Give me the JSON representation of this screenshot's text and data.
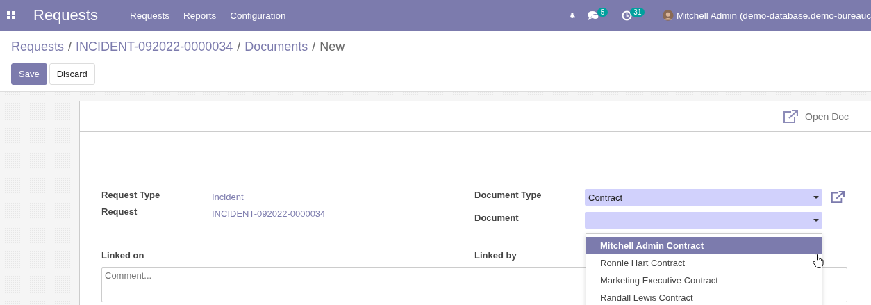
{
  "navbar": {
    "app_title": "Requests",
    "menu": [
      "Requests",
      "Reports",
      "Configuration"
    ],
    "messages_badge": "5",
    "activities_badge": "31",
    "user": "Mitchell Admin (demo-database.demo-bureauc"
  },
  "breadcrumbs": {
    "separator": "/",
    "items": [
      {
        "label": "Requests",
        "current": false
      },
      {
        "label": "INCIDENT-092022-0000034",
        "current": false
      },
      {
        "label": "Documents",
        "current": false
      },
      {
        "label": "New",
        "current": true
      }
    ]
  },
  "buttons": [
    {
      "label": "Save",
      "kind": "primary"
    },
    {
      "label": "Discard",
      "kind": "secondary"
    }
  ],
  "sheet": {
    "header_button": "Open Doc",
    "left_fields": [
      {
        "label": "Request Type",
        "value": "Incident"
      },
      {
        "label": "Request",
        "value": "INCIDENT-092022-0000034"
      }
    ],
    "right_fields": [
      {
        "label": "Document Type",
        "value": "Contract",
        "external_link": true
      },
      {
        "label": "Document",
        "external_link": false
      }
    ],
    "linked_on": {
      "label": "Linked on"
    },
    "linked_by": {
      "label": "Linked by"
    },
    "comment": {
      "placeholder": "Comment..."
    },
    "dropdown": {
      "options": [
        {
          "label": "Mitchell Admin Contract",
          "selected": true
        },
        {
          "label": "Ronnie Hart Contract",
          "selected": false
        },
        {
          "label": "Marketing Executive Contract",
          "selected": false
        },
        {
          "label": "Randall Lewis Contract",
          "selected": false
        }
      ]
    }
  }
}
